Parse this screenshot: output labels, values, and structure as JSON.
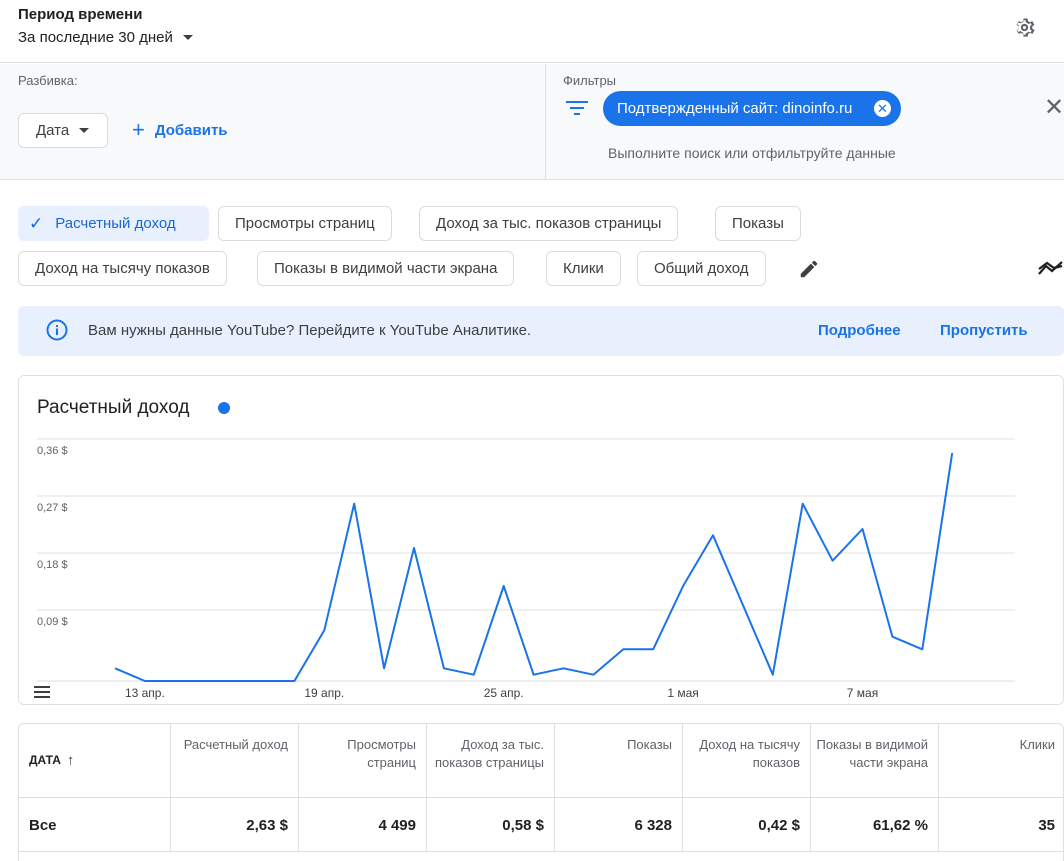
{
  "header": {
    "period_title": "Период времени",
    "period_value": "За последние 30 дней"
  },
  "breakdown": {
    "label": "Разбивка:",
    "date_chip": "Дата",
    "add_label": "Добавить"
  },
  "filters": {
    "label": "Фильтры",
    "active_chip": "Подтвержденный сайт: dinoinfo.ru",
    "search_placeholder": "Выполните поиск или отфильтруйте данные"
  },
  "metric_chips": [
    "Расчетный доход",
    "Просмотры страниц",
    "Доход за тыс. показов страницы",
    "Показы",
    "Доход на тысячу показов",
    "Показы в видимой части экрана",
    "Клики",
    "Общий доход"
  ],
  "banner": {
    "text": "Вам нужны данные YouTube? Перейдите к YouTube Аналитике.",
    "learn_more": "Подробнее",
    "skip": "Пропустить"
  },
  "chart_data": {
    "type": "line",
    "title": "Расчетный доход",
    "x_tick_labels": [
      "13 апр.",
      "19 апр.",
      "25 апр.",
      "1 мая",
      "7 мая"
    ],
    "y_tick_labels": [
      "0,36 $",
      "0,27 $",
      "0,18 $",
      "0,09 $"
    ],
    "ylim": [
      0,
      0.36
    ],
    "x_start": "2024-04-12",
    "series": [
      {
        "color": "#1a73e8",
        "values": [
          0.02,
          0.0,
          0.0,
          0.0,
          0.0,
          0.0,
          0.0,
          0.08,
          0.28,
          0.02,
          0.21,
          0.02,
          0.01,
          0.15,
          0.01,
          0.02,
          0.01,
          0.05,
          0.05,
          0.15,
          0.23,
          0.12,
          0.01,
          0.28,
          0.19,
          0.24,
          0.07,
          0.05,
          0.36
        ]
      }
    ],
    "grid": true
  },
  "table": {
    "columns": [
      "ДАТА",
      "Расчетный доход",
      "Просмотры страниц",
      "Доход за тыс. показов страницы",
      "Показы",
      "Доход на тысячу показов",
      "Показы в видимой части экрана",
      "Клики"
    ],
    "total_row": [
      "Все",
      "2,63 $",
      "4 499",
      "0,58 $",
      "6 328",
      "0,42 $",
      "61,62 %",
      "35"
    ]
  }
}
